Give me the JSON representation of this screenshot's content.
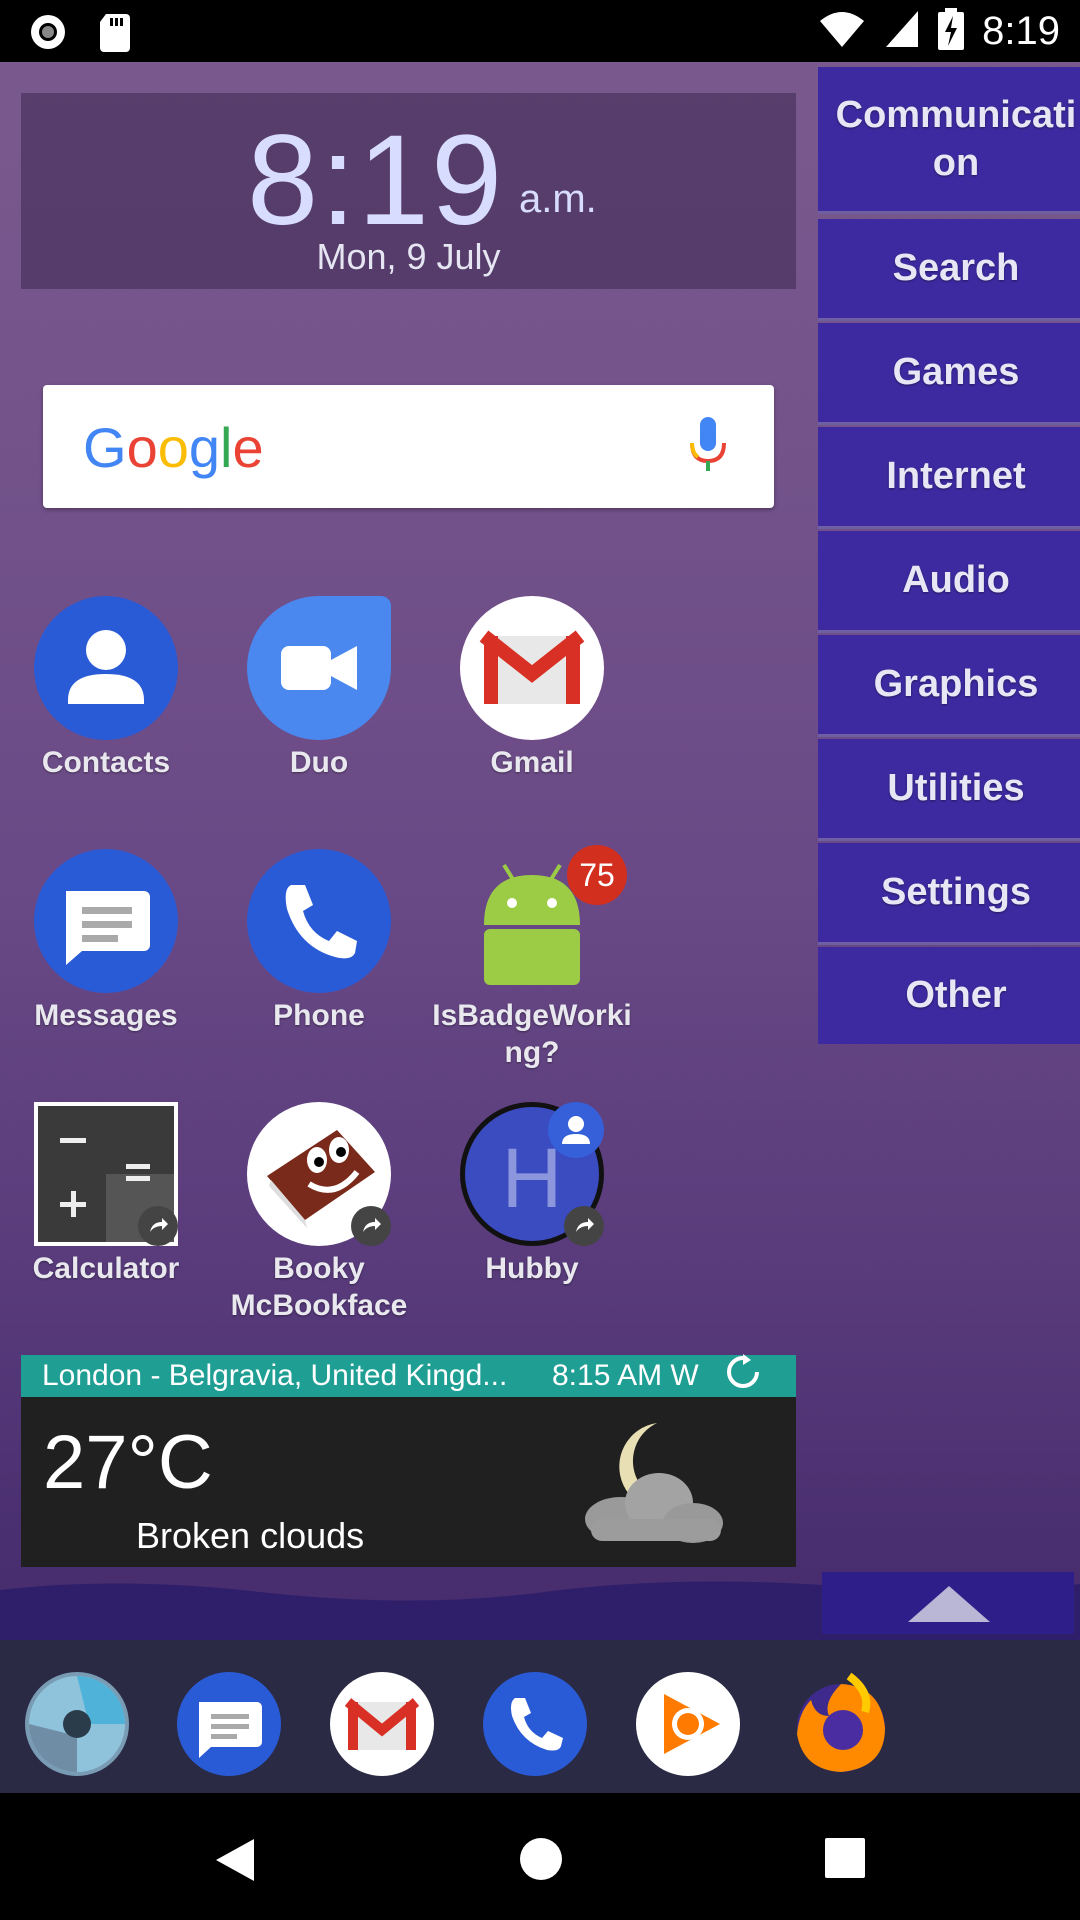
{
  "status_bar": {
    "time": "8:19",
    "icons": [
      "record-icon",
      "sd-card-icon",
      "wifi-icon",
      "signal-icon",
      "battery-charging-icon"
    ]
  },
  "clock_widget": {
    "time": "8:19",
    "ampm": "a.m.",
    "date": "Mon, 9 July"
  },
  "search_widget": {
    "logo": "Google",
    "mic_icon": "mic-icon"
  },
  "apps": [
    {
      "label": "Contacts",
      "icon": "contacts-icon",
      "color": "#2a5bd7"
    },
    {
      "label": "Duo",
      "icon": "duo-icon",
      "color": "#4a88f0"
    },
    {
      "label": "Gmail",
      "icon": "gmail-icon",
      "color": "#ffffff"
    },
    {
      "label": "Messages",
      "icon": "messages-icon",
      "color": "#2a5bd7"
    },
    {
      "label": "Phone",
      "icon": "phone-icon",
      "color": "#2a5bd7"
    },
    {
      "label": "IsBadgeWorking?",
      "icon": "android-icon",
      "color": "#9ccc45",
      "badge": "75"
    },
    {
      "label": "Calculator",
      "icon": "calculator-icon",
      "color": "#3a3a3a"
    },
    {
      "label": "Booky McBookface",
      "icon": "book-face-icon",
      "color": "#ffffff"
    },
    {
      "label": "Hubby",
      "icon": "contact-h-icon",
      "color": "#3b4bc0"
    }
  ],
  "categories": [
    "Communication",
    "Search",
    "Games",
    "Internet",
    "Audio",
    "Graphics",
    "Utilities",
    "Settings",
    "Other"
  ],
  "weather": {
    "location": "London - Belgravia, United Kingd...",
    "updated": "8:15 AM W",
    "temperature": "27°C",
    "condition": "Broken clouds",
    "icon": "moon-cloud-icon",
    "refresh_icon": "refresh-icon"
  },
  "up_button_icon": "up-arrow-icon",
  "dock": [
    "camera-icon",
    "messages-icon",
    "gmail-icon",
    "phone-icon",
    "play-music-icon",
    "firefox-icon"
  ],
  "nav": [
    "back-icon",
    "home-icon",
    "recents-icon"
  ],
  "colors": {
    "category_bg": "#3d2aa0",
    "weather_header": "#1f9e94",
    "badge": "#d32f1f"
  }
}
